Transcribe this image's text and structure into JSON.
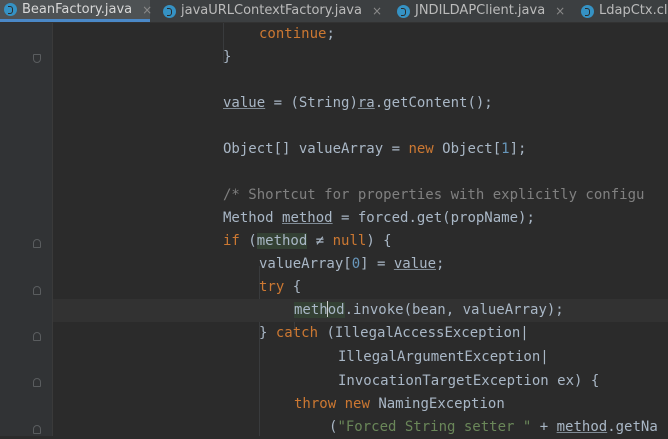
{
  "tabs": [
    {
      "label": "BeanFactory.java",
      "active": true
    },
    {
      "label": "javaURLContextFactory.java",
      "active": false
    },
    {
      "label": "JNDILDAPClient.java",
      "active": false
    },
    {
      "label": "LdapCtx.cla",
      "active": false
    }
  ],
  "close_glyph": "×",
  "code": {
    "l1": {
      "kw": "continue",
      "p": ";"
    },
    "l2": {
      "p": "}"
    },
    "l3": {
      "a": "value",
      "b": " = (String)",
      "c": "ra",
      "d": ".getContent();"
    },
    "l4": {
      "a": "Object[] valueArray = ",
      "kw": "new",
      "b": " Object[",
      "num": "1",
      "c": "];"
    },
    "l5": {
      "cm": "/* Shortcut for properties with explicitly configu"
    },
    "l6": {
      "a": "Method ",
      "b": "method",
      "c": " = forced.get(propName);"
    },
    "l7": {
      "kw": "if",
      "a": " (",
      "b": "method",
      "c": " ≠ ",
      "kw2": "null",
      "d": ") {"
    },
    "l8": {
      "a": "valueArray[",
      "num": "0",
      "b": "] = ",
      "c": "value",
      "d": ";"
    },
    "l9": {
      "kw": "try",
      "a": " {"
    },
    "l10": {
      "a": "meth",
      "b": "od",
      "c": ".invoke(bean, valueArray);"
    },
    "l11": {
      "a": "} ",
      "kw": "catch",
      "b": " (IllegalAccessException|"
    },
    "l12": {
      "a": "IllegalArgumentException|"
    },
    "l13": {
      "a": "InvocationTargetException ex) {"
    },
    "l14": {
      "kw": "throw",
      "a": " ",
      "kw2": "new",
      "b": " NamingException"
    },
    "l15": {
      "a": "(",
      "str": "\"Forced String setter \"",
      "b": " + ",
      "c": "method",
      "d": ".getNa"
    }
  }
}
